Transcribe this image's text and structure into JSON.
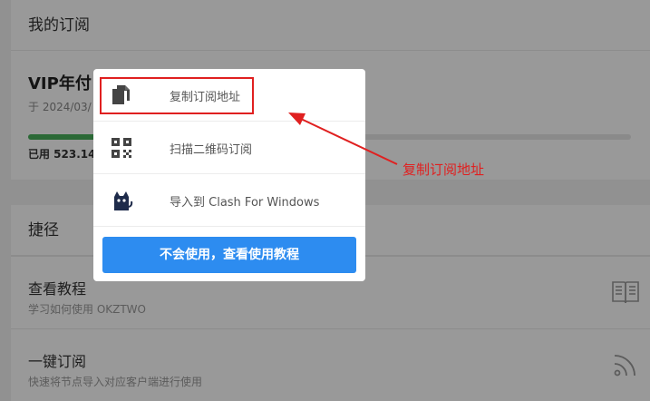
{
  "subscriptions": {
    "header": "我的订阅",
    "plan_name": "VIP年付",
    "expire_text": "于 2024/03/",
    "usage_text": "已用 523.14",
    "usage_fraction": 0.44
  },
  "shortcuts": {
    "header": "捷径",
    "items": [
      {
        "title": "查看教程",
        "desc": "学习如何使用 OKZTWO",
        "icon": "book-icon"
      },
      {
        "title": "一键订阅",
        "desc": "快速将节点导入对应客户端进行使用",
        "icon": "rss-icon"
      }
    ]
  },
  "popup": {
    "items": [
      {
        "label": "复制订阅地址",
        "icon": "copy-icon"
      },
      {
        "label": "扫描二维码订阅",
        "icon": "qr-code-icon"
      },
      {
        "label": "导入到 Clash For Windows",
        "icon": "clash-cat-icon"
      }
    ],
    "help_button": "不会使用，查看使用教程"
  },
  "annotation": {
    "text": "复制订阅地址",
    "color": "#e02020"
  },
  "colors": {
    "primary_button": "#2d8cf0",
    "progress": "#48b05a"
  }
}
